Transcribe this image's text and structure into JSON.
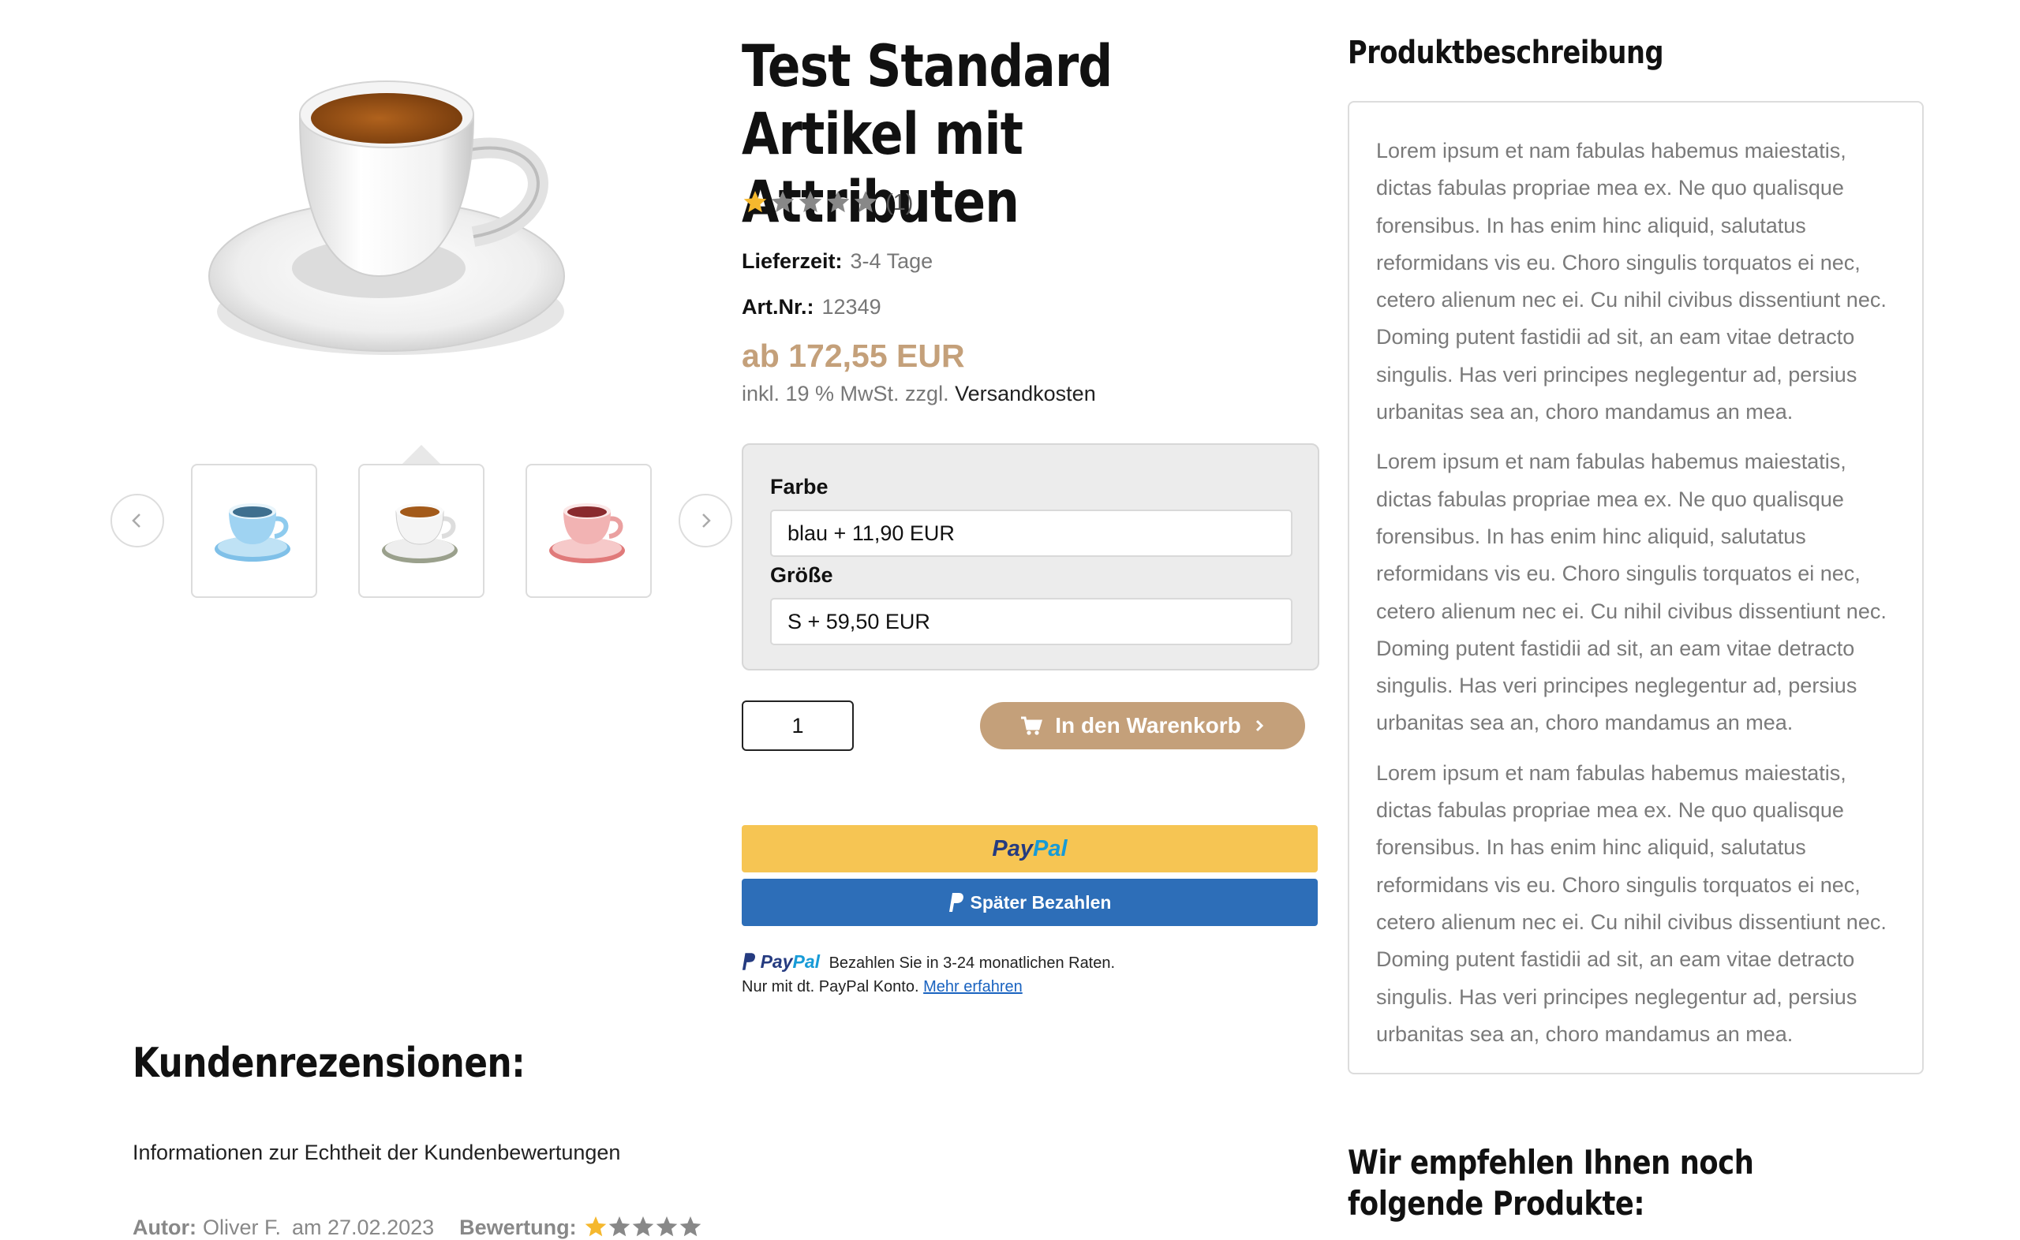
{
  "product": {
    "title": "Test Standard Artikel mit Attributen",
    "rating_count": "(1)",
    "rating_value": 1,
    "rating_max": 5,
    "delivery_label": "Lieferzeit:",
    "delivery_value": "3-4 Tage",
    "sku_label": "Art.Nr.:",
    "sku_value": "12349",
    "price": "ab 172,55 EUR",
    "tax_text": "inkl. 19 % MwSt. zzgl.",
    "shipping_link": "Versandkosten"
  },
  "gallery": {
    "thumbnails": [
      "blue-cup-thumbnail",
      "white-cup-thumbnail",
      "pink-cup-thumbnail"
    ],
    "selected_index": 1
  },
  "variants": {
    "color_label": "Farbe",
    "color_value": "blau + 11,90 EUR",
    "size_label": "Größe",
    "size_value": "S + 59,50 EUR"
  },
  "cart": {
    "quantity": "1",
    "button_label": "In den Warenkorb"
  },
  "paypal": {
    "logo_part1": "Pay",
    "logo_part2": "Pal",
    "later_label": "Später Bezahlen",
    "message": "Bezahlen Sie in 3-24 monatlichen Raten.",
    "message_line2": "Nur mit dt. PayPal Konto.",
    "learn_more": "Mehr erfahren"
  },
  "description": {
    "title": "Produktbeschreibung",
    "paragraphs": [
      "Lorem ipsum et nam fabulas habemus maiestatis, dictas fabulas propriae mea ex. Ne quo qualisque forensibus. In has enim hinc aliquid, salutatus reformidans vis eu. Choro singulis torquatos ei nec, cetero alienum nec ei. Cu nihil civibus dissentiunt nec. Doming putent fastidii ad sit, an eam vitae detracto singulis. Has veri principes neglegentur ad, persius urbanitas sea an, choro mandamus an mea.",
      "Lorem ipsum et nam fabulas habemus maiestatis, dictas fabulas propriae mea ex. Ne quo qualisque forensibus. In has enim hinc aliquid, salutatus reformidans vis eu. Choro singulis torquatos ei nec, cetero alienum nec ei. Cu nihil civibus dissentiunt nec. Doming putent fastidii ad sit, an eam vitae detracto singulis. Has veri principes neglegentur ad, persius urbanitas sea an, choro mandamus an mea.",
      "Lorem ipsum et nam fabulas habemus maiestatis, dictas fabulas propriae mea ex. Ne quo qualisque forensibus. In has enim hinc aliquid, salutatus reformidans vis eu. Choro singulis torquatos ei nec, cetero alienum nec ei. Cu nihil civibus dissentiunt nec. Doming putent fastidii ad sit, an eam vitae detracto singulis. Has veri principes neglegentur ad, persius urbanitas sea an, choro mandamus an mea."
    ]
  },
  "recommendations": {
    "title": "Wir empfehlen Ihnen noch folgende Produkte:"
  },
  "reviews": {
    "title": "Kundenrezensionen:",
    "info_link": "Informationen zur Echtheit der Kundenbewertungen",
    "author_label": "Autor:",
    "author_value": "Oliver F.",
    "date": "am 27.02.2023",
    "rating_label": "Bewertung:",
    "rating_value": 1,
    "rating_max": 5
  },
  "colors": {
    "accent": "#c4a07a",
    "paypal_yellow": "#f6c553",
    "paypal_blue": "#2d6eb8",
    "star_filled": "#f5b82e",
    "star_empty": "#888888"
  }
}
